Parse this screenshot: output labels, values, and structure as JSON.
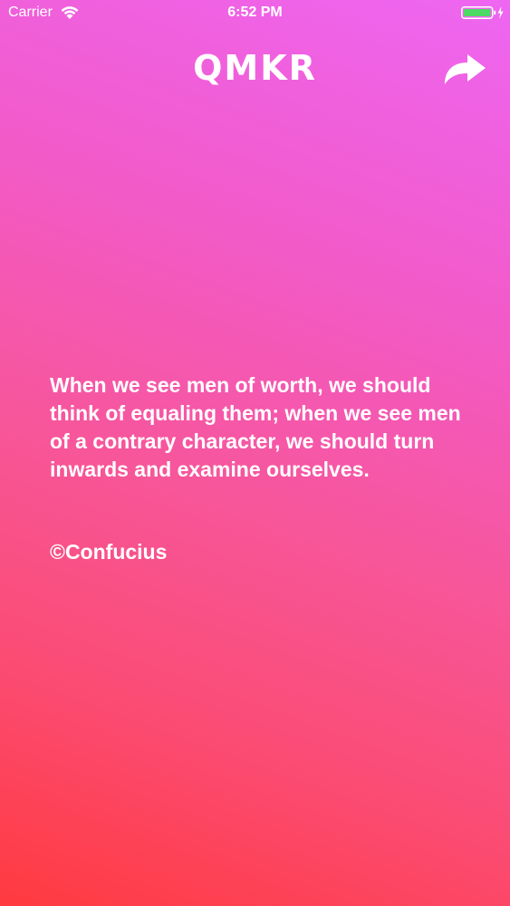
{
  "status_bar": {
    "carrier": "Carrier",
    "time": "6:52 PM",
    "wifi_icon": "wifi-icon",
    "battery_icon": "battery-charging-icon",
    "battery_color": "#4cd964",
    "charging_icon": "bolt-icon"
  },
  "header": {
    "logo_text": "QMKR",
    "share_icon": "share-arrow-icon"
  },
  "quote": {
    "text": "When we see men of worth, we should think of equaling them; when we see men of a contrary character, we should turn inwards and examine ourselves.",
    "author": "©Confucius"
  },
  "colors": {
    "gradient_top": "#ee66f2",
    "gradient_bottom": "#ff3a3f",
    "text": "#ffffff"
  }
}
